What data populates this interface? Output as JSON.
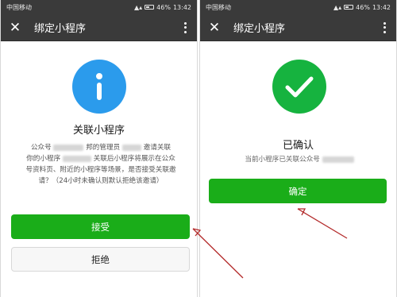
{
  "statusbar": {
    "carrier": "中国移动",
    "battery": "46%",
    "time": "13:42"
  },
  "left_screen": {
    "title": "绑定小程序",
    "heading": "关联小程序",
    "body_lines": [
      {
        "before": "公众号",
        "after": "邦的管理员",
        "after2": "邀请关联"
      },
      {
        "before": "你的小程序",
        "after": "关联后小程序将展示在公众"
      },
      {
        "text": "号资料页、附近的小程序等场景，是否接受关联邀"
      },
      {
        "text": "请？（24小时未确认则默认拒绝该邀请）"
      }
    ],
    "accept_label": "接受",
    "reject_label": "拒绝"
  },
  "right_screen": {
    "title": "绑定小程序",
    "heading": "已确认",
    "message": "当前小程序已关联公众号",
    "confirm_label": "确定"
  },
  "colors": {
    "primary_green": "#1aad19",
    "info_blue": "#2b9bec",
    "success_green": "#16b33f",
    "annotation_red": "#b32a2a",
    "toolbar_bg": "#3a3a3a"
  },
  "icons": {
    "close": "close-icon",
    "more": "more-vertical-icon",
    "info": "info-icon",
    "check": "check-icon"
  }
}
